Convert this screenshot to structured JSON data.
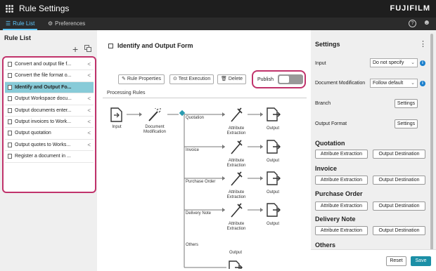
{
  "app": {
    "title": "Rule Settings",
    "brand": "FUJIFILM"
  },
  "tabs": [
    {
      "label": "Rule List"
    },
    {
      "label": "Preferences"
    }
  ],
  "header_icons": {
    "help": "?",
    "user": "user-icon"
  },
  "rule_list": {
    "title": "Rule List",
    "items": [
      {
        "label": "Convert and output file f..."
      },
      {
        "label": "Convert the file format o..."
      },
      {
        "label": "Identify and Output Fo..."
      },
      {
        "label": "Output Workspace docu..."
      },
      {
        "label": "Output documents enter..."
      },
      {
        "label": "Output invoices to Work..."
      },
      {
        "label": "Output quotation"
      },
      {
        "label": "Output quotes to Works..."
      },
      {
        "label": "Register a document in ..."
      }
    ],
    "selected_index": 2
  },
  "main": {
    "form_title": "Identify and Output Form",
    "buttons": {
      "rule_properties": "Rule Properties",
      "test_execution": "Test Execution",
      "delete": "Delete"
    },
    "publish": {
      "label": "Publish",
      "state": "off"
    },
    "processing_rules": "Processing Rules",
    "nodes": {
      "input": "Input",
      "doc_mod_1": "Document",
      "doc_mod_2": "Modification",
      "attr_1": "Attribute",
      "attr_2": "Extraction",
      "output": "Output"
    },
    "branches": [
      "Quotation",
      "Invoice",
      "Purchase Order",
      "Delivery Note",
      "Others"
    ]
  },
  "settings": {
    "title": "Settings",
    "input_label": "Input",
    "input_value": "Do not specify",
    "doc_mod_label": "Document Modification",
    "doc_mod_value": "Follow default",
    "branch_label": "Branch",
    "output_format_label": "Output Format",
    "settings_button": "Settings",
    "sections": [
      {
        "title": "Quotation"
      },
      {
        "title": "Invoice"
      },
      {
        "title": "Purchase Order"
      },
      {
        "title": "Delivery Note"
      },
      {
        "title": "Others"
      }
    ],
    "attr_btn": "Attribute Extraction",
    "dest_btn": "Output Destination",
    "reset": "Reset",
    "save": "Save"
  },
  "colors": {
    "accent": "#1b8fa6",
    "highlight": "#c0336b",
    "selected_row": "#88cbd8",
    "dark_bar": "#1e1e1e"
  }
}
